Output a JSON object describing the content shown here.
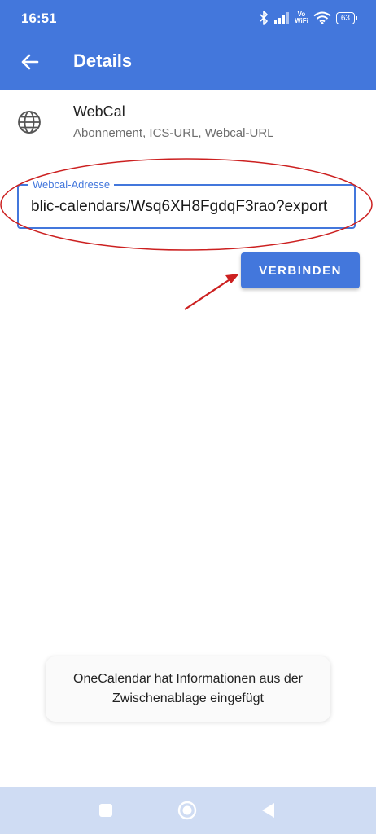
{
  "status_bar": {
    "time": "16:51",
    "icons": [
      "bluetooth-icon",
      "signal-icon",
      "vowifi-icon",
      "wifi-icon",
      "battery-icon"
    ],
    "vowifi_top": "Vo",
    "vowifi_bottom": "WiFi",
    "battery_level": "63"
  },
  "app_bar": {
    "title": "Details",
    "back_icon": "arrow-back-icon",
    "background": "#4377dc"
  },
  "provider": {
    "icon": "globe-icon",
    "name": "WebCal",
    "description": "Abonnement, ICS-URL, Webcal-URL"
  },
  "webcal_field": {
    "label": "Webcal-Adresse",
    "value": "blic-calendars/Wsq6XH8FgdqF3rao?export",
    "accent_color": "#4377dc"
  },
  "connect_button": {
    "label": "VERBINDEN"
  },
  "annotations": {
    "highlight_color": "#cc2020"
  },
  "toast": {
    "line1": "OneCalendar hat Informationen aus der",
    "line2": "Zwischenablage eingefügt"
  },
  "nav_bar": {
    "buttons": [
      "recents-square-icon",
      "home-circle-icon",
      "back-triangle-icon"
    ]
  }
}
